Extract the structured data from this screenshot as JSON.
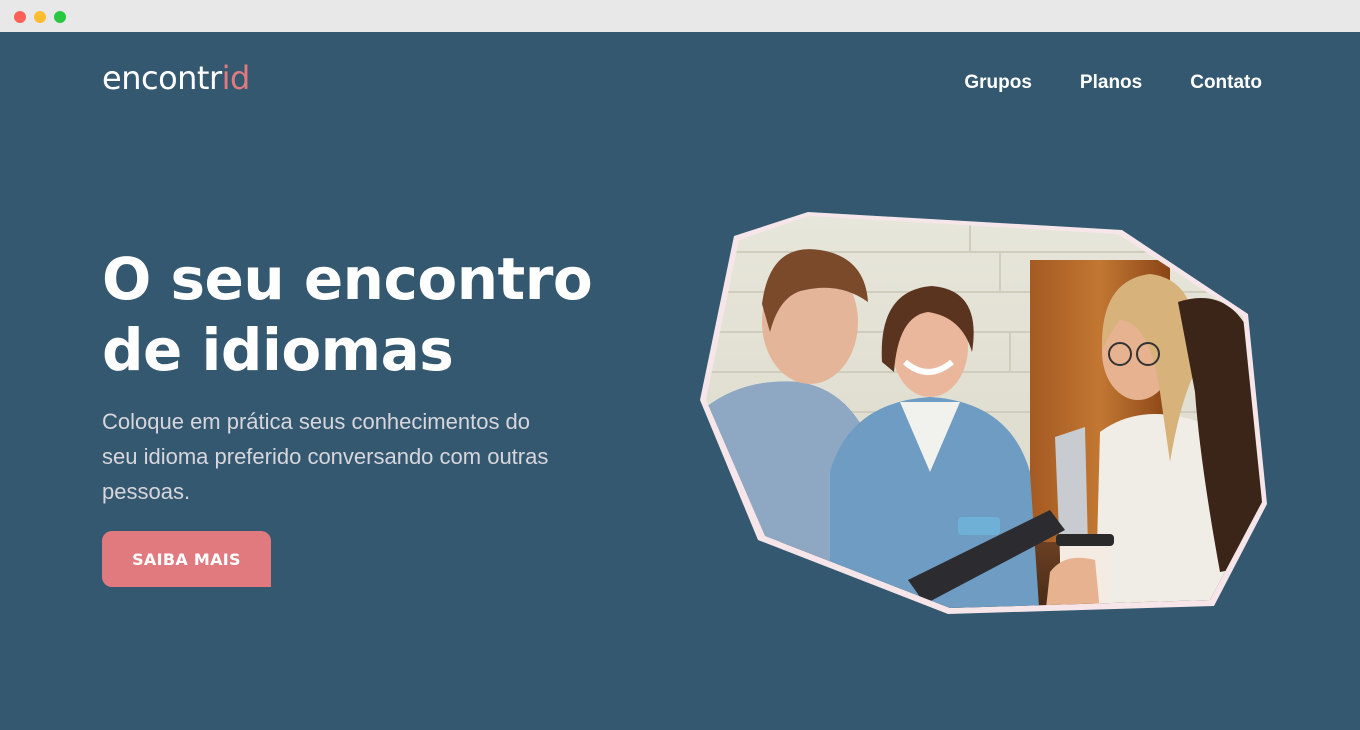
{
  "window": {
    "controls": [
      "close",
      "minimize",
      "maximize"
    ]
  },
  "header": {
    "logo_main": "encontr",
    "logo_accent": "id",
    "nav": [
      {
        "label": "Grupos"
      },
      {
        "label": "Planos"
      },
      {
        "label": "Contato"
      }
    ]
  },
  "hero": {
    "title_line1": "O seu encontro",
    "title_line2": "de idiomas",
    "subtitle": "Coloque em prática seus conhecimentos do seu idioma preferido conversando com outras pessoas.",
    "cta_label": "SAIBA MAIS",
    "image_icon": "group-photo-icon"
  },
  "colors": {
    "background": "#345870",
    "accent": "#e07a7e",
    "text": "#ffffff",
    "subtitle_text": "#d6d6dc",
    "image_border": "#f6e6ea"
  }
}
